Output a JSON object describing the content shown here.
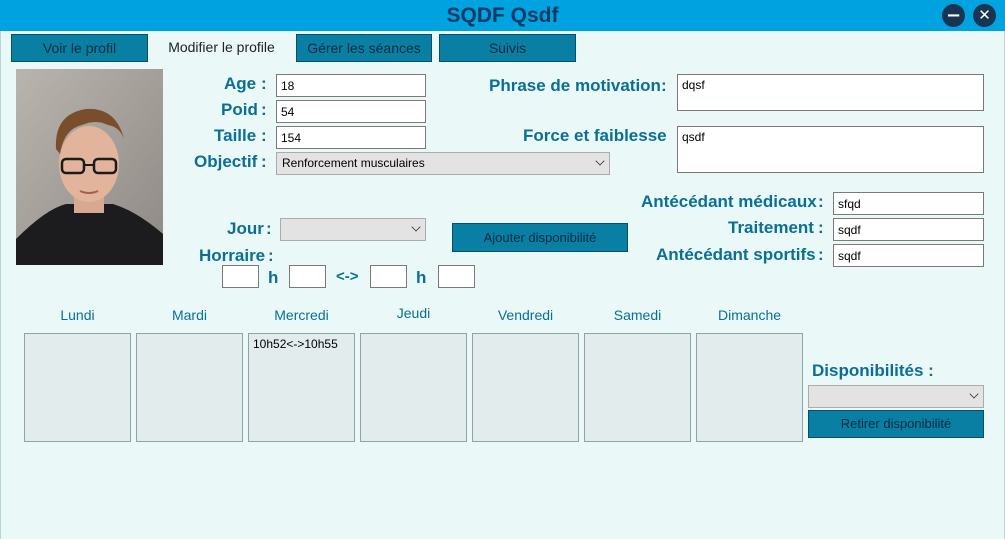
{
  "window": {
    "title": "SQDF Qsdf",
    "minimize_glyph": "−",
    "close_glyph": "✕"
  },
  "tabs": [
    {
      "label": "Voir le profil"
    },
    {
      "label": "Modifier le profile"
    },
    {
      "label": "Gérer les séances"
    },
    {
      "label": "Suivis"
    }
  ],
  "profile": {
    "age": {
      "label": "Age",
      "value": "18"
    },
    "poid": {
      "label": "Poid",
      "value": "54"
    },
    "taille": {
      "label": "Taille",
      "value": "154"
    },
    "objectif": {
      "label": "Objectif",
      "value": "Renforcement musculaires"
    },
    "colon": ":"
  },
  "motivation": {
    "phrase": {
      "label": "Phrase de motivation",
      "value": "dqsf"
    },
    "force": {
      "label": "Force et faiblesse",
      "value": "qsdf"
    }
  },
  "medical": {
    "antecedant_medicaux": {
      "label": "Antécédant médicaux",
      "value": "sfqd"
    },
    "traitement": {
      "label": "Traitement",
      "value": "sqdf"
    },
    "antecedant_sportifs": {
      "label": "Antécédant sportifs",
      "value": "sqdf"
    }
  },
  "availability": {
    "jour_label": "Jour",
    "jour_value": "",
    "horraire_label": "Horraire",
    "h_label": "h",
    "separator": "<->",
    "add_button": "Ajouter disponibilité",
    "start_hour": "",
    "start_min": "",
    "end_hour": "",
    "end_min": ""
  },
  "week": {
    "days": [
      "Lundi",
      "Mardi",
      "Mercredi",
      "Jeudi",
      "Vendredi",
      "Samedi",
      "Dimanche"
    ],
    "slots": [
      "",
      "",
      "10h52<->10h55",
      "",
      "",
      "",
      ""
    ]
  },
  "disponibilites": {
    "label": "Disponibilités :",
    "selected": "",
    "remove_button": "Retirer disponibilité"
  },
  "colors": {
    "accent": "#00a2e0",
    "button": "#0a7fa4",
    "label": "#0a6f95",
    "title": "#0a3a66"
  }
}
